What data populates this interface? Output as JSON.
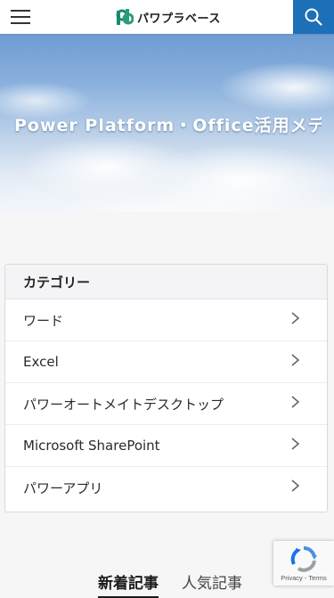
{
  "header": {
    "logo_text": "パワプラベース",
    "menu_icon": "hamburger-menu-icon",
    "search_icon": "search-icon",
    "accent_color": "#1d6fb8"
  },
  "hero": {
    "title": "Power Platform・Office活用メディア"
  },
  "category": {
    "heading": "カテゴリー",
    "items": [
      {
        "label": "ワード"
      },
      {
        "label": "Excel"
      },
      {
        "label": "パワーオートメイトデスクトップ"
      },
      {
        "label": "Microsoft SharePoint"
      },
      {
        "label": "パワーアプリ"
      }
    ],
    "chevron_icon": "chevron-right-icon"
  },
  "tabs": {
    "items": [
      {
        "label": "新着記事",
        "active": true
      },
      {
        "label": "人気記事",
        "active": false
      }
    ]
  },
  "recaptcha": {
    "privacy": "Privacy",
    "separator": " - ",
    "terms": "Terms"
  }
}
